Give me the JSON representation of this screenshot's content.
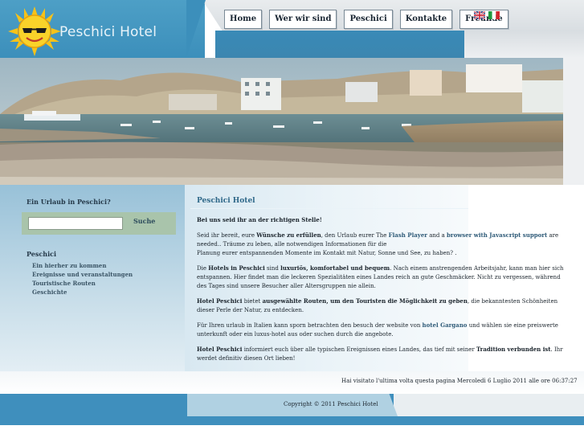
{
  "site": {
    "title": "Peschici Hotel"
  },
  "nav": {
    "items": [
      {
        "label": "Home"
      },
      {
        "label": "Wer wir sind"
      },
      {
        "label": "Peschici"
      },
      {
        "label": "Kontakte"
      },
      {
        "label": "Freunde"
      }
    ],
    "flags": [
      {
        "icon": "flag-uk-icon"
      },
      {
        "icon": "flag-it-icon"
      }
    ]
  },
  "sidebar": {
    "title": "Ein Urlaub in Peschici?",
    "search": {
      "placeholder": "",
      "value": "",
      "button_label": "Suche"
    },
    "section_title": "Peschici",
    "links": [
      {
        "label": "Ein hierher zu kommen"
      },
      {
        "label": "Ereignisse und veranstaltungen"
      },
      {
        "label": "Touristische Routen"
      },
      {
        "label": "Geschichte"
      }
    ]
  },
  "main": {
    "title": "Peschici Hotel",
    "p1": "Bei uns seid ihr an der richtigen Stelle!",
    "p2a": "Seid ihr bereit, eure ",
    "p2b": "Wünsche zu erfüllen",
    "p2c": ", den Urlaub eurer The ",
    "p2d": "Flash Player",
    "p2e": " and a ",
    "p2f": "browser with Javascript support",
    "p2g": " are needed.. Träume zu leben, alle notwendigen Informationen für die",
    "p2h": "Planung eurer entspannenden Momente im Kontakt mit Natur, Sonne und See, zu haben? .",
    "p3a": "Die ",
    "p3b": "Hotels in Peschici",
    "p3c": " sind ",
    "p3d": "luxuriös, komfortabel und bequem",
    "p3e": ". Nach einem anstrengenden Arbeitsjahr, kann man hier sich entspannen. Hier findet man die leckeren Spezialitäten eines Landes reich an gute Geschmäcker. Nicht zu vergessen, während des Tages sind unsere Besucher aller Altersgruppen nie allein.",
    "p4a": "Hotel Peschici",
    "p4b": " bietet ",
    "p4c": "ausgewählte Routen, um den Touristen die Möglichkeit zu geben",
    "p4d": ", die bekanntesten Schönheiten dieser Perle der Natur, zu entdecken.",
    "p5a": "Für Ihren urlaub in Italien kann sporn betrachten den besuch der website von ",
    "p5b": "hotel Gargano",
    "p5c": " und wählen sie eine preiswerte unterkunft oder ein luxus-hotel aus oder suchen durch die angebote.",
    "p6a": "Hotel Peschici",
    "p6b": " informiert euch über alle typischen Ereignissen eines Landes, das tief mit seiner ",
    "p6c": "Tradition verbunden ist",
    "p6d": ". Ihr werdet definitiv diesen Ort lieben!"
  },
  "last_visit": "Hai visitato l'ultima volta questa pagina Mercoledì 6 Luglio 2011 alle ore 06:37:27",
  "footer": {
    "copyright": "Copyright © 2011 Peschici Hotel"
  },
  "colors": {
    "header_blue": "#3c8fbb",
    "link_blue": "#2f5b78",
    "title_blue": "#2f6889",
    "search_green": "#a9c4ab"
  }
}
